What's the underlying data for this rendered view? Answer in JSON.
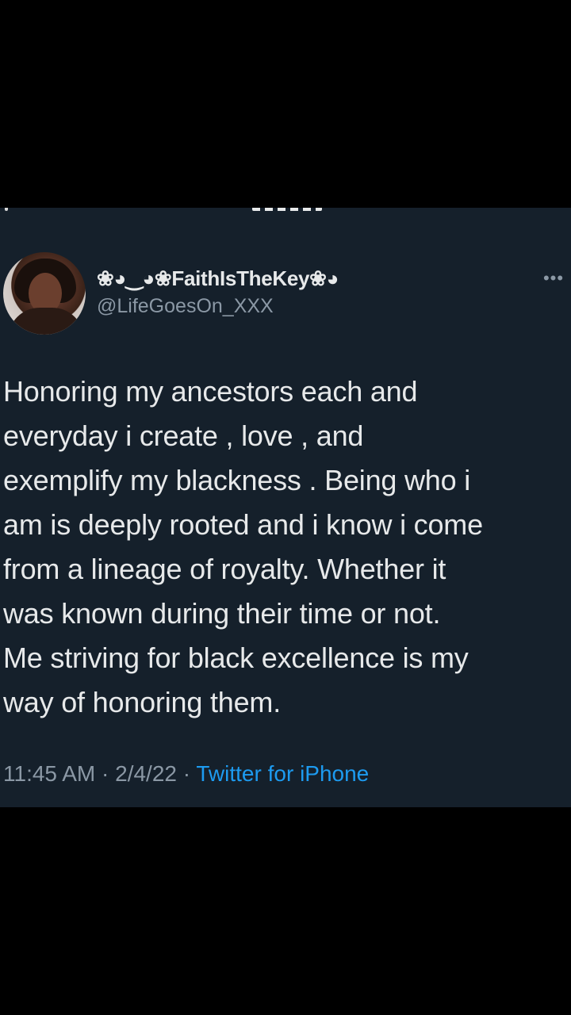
{
  "tweet": {
    "author": {
      "display_name": "❀◕‿◕❀FaithIsTheKey❀◕",
      "handle": "@LifeGoesOn_XXX"
    },
    "more_icon": "more-horizontal-icon",
    "text": "Honoring my ancestors each and\neveryday i create , love , and\nexemplify  my blackness . Being who i\nam is deeply rooted and i know i come\nfrom a lineage of royalty. Whether it\nwas known during their time or not.\nMe striving for black excellence is my\nway of honoring them.",
    "time": "11:45 AM",
    "separator": " · ",
    "date": "2/4/22",
    "source": "Twitter for iPhone"
  },
  "colors": {
    "page_background": "#000000",
    "card_background": "#15202b",
    "primary_text": "#e7e9ea",
    "secondary_text": "#8b98a5",
    "link": "#1d9bf0"
  }
}
